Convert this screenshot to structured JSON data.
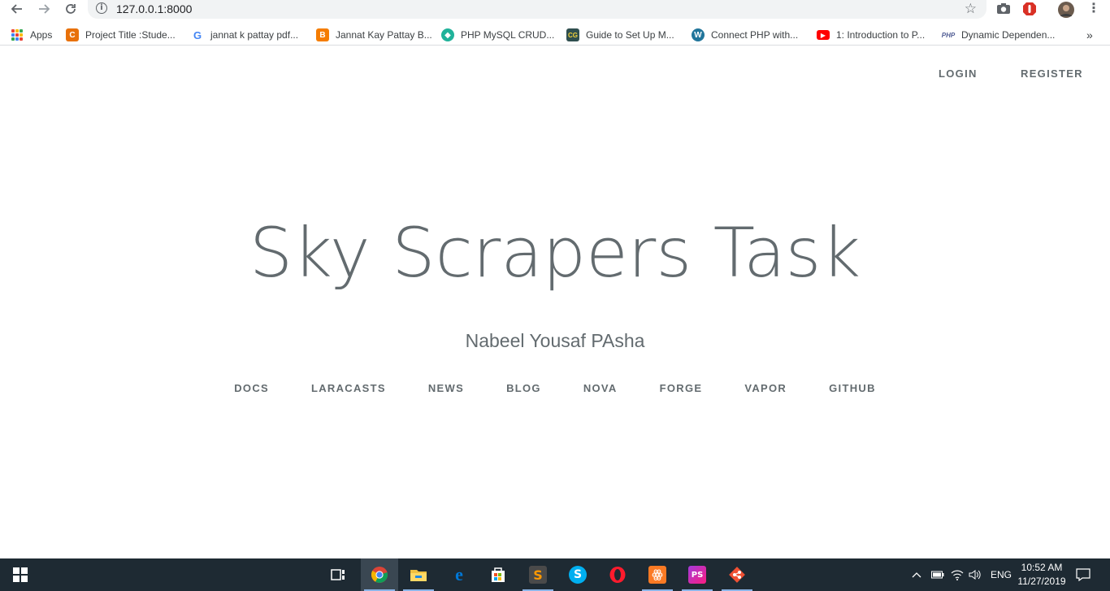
{
  "browser": {
    "url": "127.0.0.1:8000",
    "bookmarks": [
      {
        "label": "Apps",
        "icon": "apps-grid-icon"
      },
      {
        "label": "Project Title :Stude...",
        "icon": "c-favicon",
        "color": "#e8710a",
        "glyph": "C"
      },
      {
        "label": "jannat k pattay pdf...",
        "icon": "google-favicon",
        "color": "#4285f4",
        "glyph": "G"
      },
      {
        "label": "Jannat Kay Pattay B...",
        "icon": "blogger-favicon",
        "color": "#f57d00",
        "glyph": "B"
      },
      {
        "label": "PHP MySQL CRUD...",
        "icon": "gem-favicon",
        "color": "#20b29a",
        "glyph": "◆"
      },
      {
        "label": "Guide to Set Up M...",
        "icon": "cg-favicon",
        "color": "#2f4f4f",
        "glyph": "CG"
      },
      {
        "label": "Connect PHP with...",
        "icon": "wordpress-favicon",
        "color": "#21759b",
        "glyph": "W"
      },
      {
        "label": "1: Introduction to P...",
        "icon": "youtube-favicon",
        "color": "#ff0000",
        "glyph": "▶"
      },
      {
        "label": "Dynamic Dependen...",
        "icon": "php-favicon",
        "color": "#4f5b93",
        "glyph": "PHP"
      }
    ],
    "overflow": "»"
  },
  "page": {
    "auth": {
      "login": "LOGIN",
      "register": "REGISTER"
    },
    "title": "Sky Scrapers Task",
    "subtitle": "Nabeel Yousaf PAsha",
    "links": [
      "DOCS",
      "LARACASTS",
      "NEWS",
      "BLOG",
      "NOVA",
      "FORGE",
      "VAPOR",
      "GITHUB"
    ]
  },
  "taskbar": {
    "tray": {
      "language": "ENG",
      "time": "10:52 AM",
      "date": "11/27/2019"
    },
    "apps": [
      {
        "name": "task-view-icon"
      },
      {
        "name": "chrome-icon",
        "color": "#db4437"
      },
      {
        "name": "file-explorer-icon",
        "color": "#f0c040"
      },
      {
        "name": "edge-icon",
        "color": "#0078d7"
      },
      {
        "name": "store-icon",
        "color": "#ffffff"
      },
      {
        "name": "sublime-text-icon",
        "color": "#ff9800"
      },
      {
        "name": "skype-icon",
        "color": "#00aff0"
      },
      {
        "name": "opera-icon",
        "color": "#ff1b2d"
      },
      {
        "name": "xampp-icon",
        "color": "#fb7a24"
      },
      {
        "name": "phpstorm-icon",
        "color": "#a43adb"
      },
      {
        "name": "git-icon",
        "color": "#f05033"
      }
    ]
  },
  "colors": {
    "text": "#636b6f",
    "taskbar": "#1e2a33",
    "omnibox": "#f1f3f4"
  }
}
